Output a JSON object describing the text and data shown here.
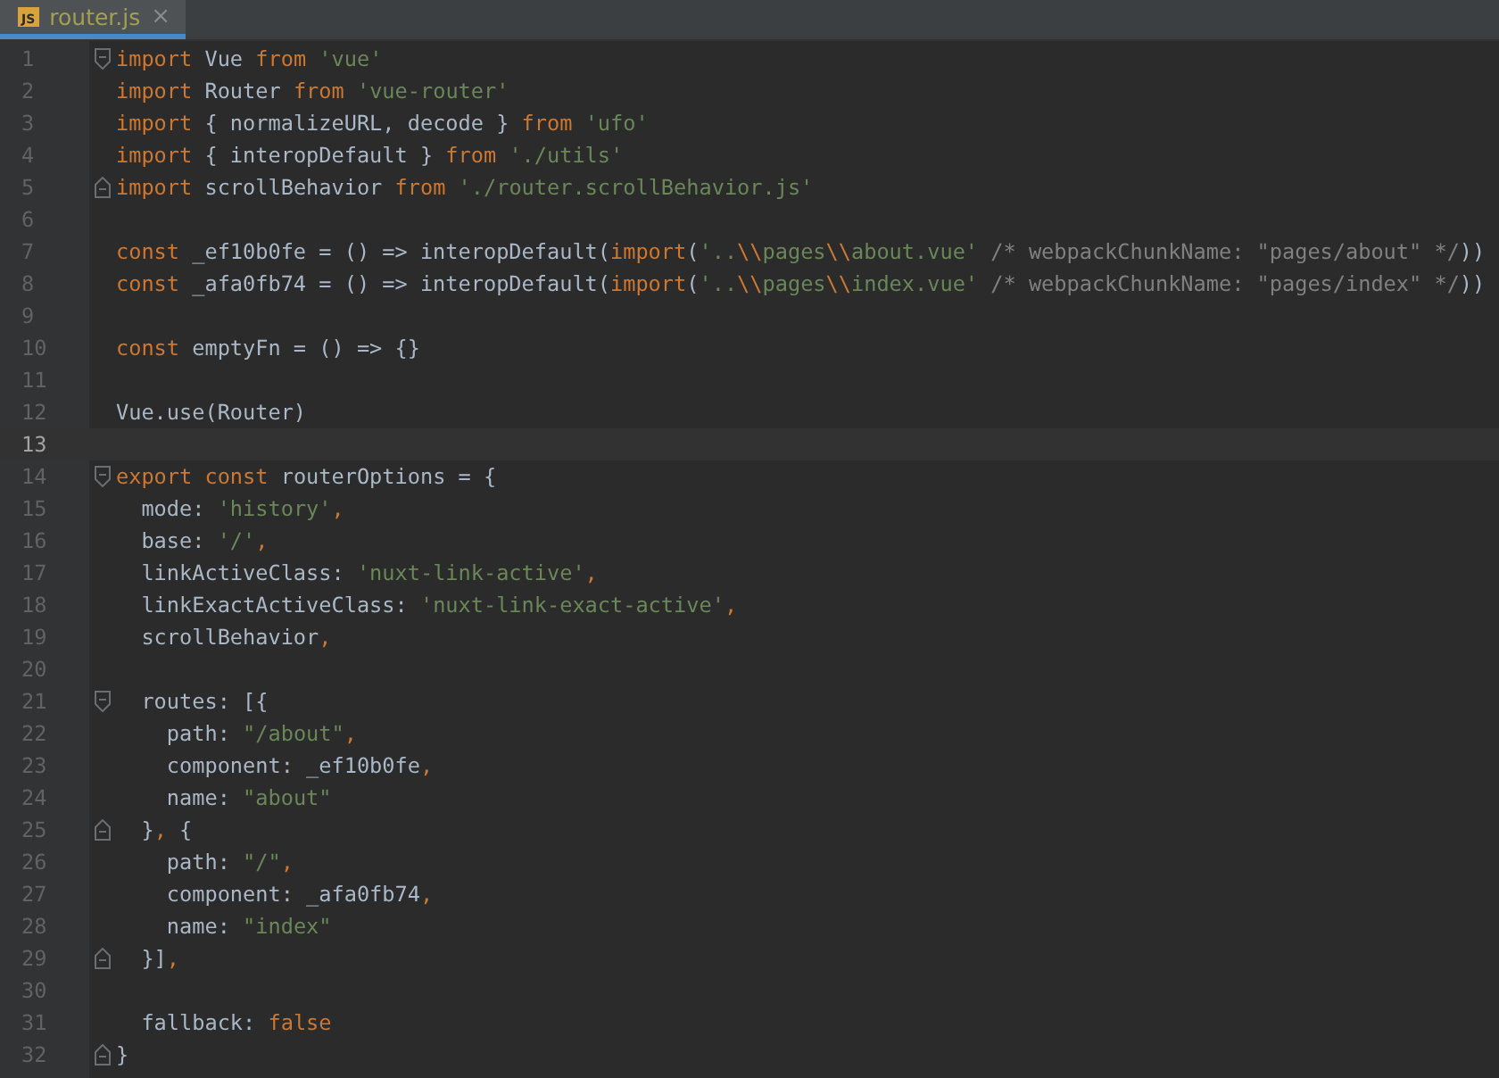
{
  "tab": {
    "label": "router.js",
    "icon_text": "JS",
    "close": "×",
    "selected": true
  },
  "lines": [
    {
      "number": "1",
      "current": false,
      "fold_start": true,
      "tokens": [
        {
          "kind": "kw",
          "t": "import"
        },
        {
          "kind": "pl",
          "t": " Vue "
        },
        {
          "kind": "kw",
          "t": "from"
        },
        {
          "kind": "str",
          "t": " 'vue'"
        }
      ]
    },
    {
      "number": "2",
      "current": false,
      "tokens": [
        {
          "kind": "kw",
          "t": "import"
        },
        {
          "kind": "pl",
          "t": " Router "
        },
        {
          "kind": "kw",
          "t": "from"
        },
        {
          "kind": "str",
          "t": " 'vue-router'"
        }
      ]
    },
    {
      "number": "3",
      "current": false,
      "tokens": [
        {
          "kind": "kw",
          "t": "import"
        },
        {
          "kind": "pl",
          "t": " { normalizeURL, decode } "
        },
        {
          "kind": "kw",
          "t": "from"
        },
        {
          "kind": "str",
          "t": " 'ufo'"
        }
      ]
    },
    {
      "number": "4",
      "current": false,
      "tokens": [
        {
          "kind": "kw",
          "t": "import"
        },
        {
          "kind": "pl",
          "t": " { interopDefault } "
        },
        {
          "kind": "kw",
          "t": "from"
        },
        {
          "kind": "str",
          "t": " './utils'"
        }
      ]
    },
    {
      "number": "5",
      "current": false,
      "fold_end": true,
      "tokens": [
        {
          "kind": "kw",
          "t": "import"
        },
        {
          "kind": "pl",
          "t": " scrollBehavior "
        },
        {
          "kind": "kw",
          "t": "from"
        },
        {
          "kind": "str",
          "t": " './router.scrollBehavior.js'"
        }
      ]
    },
    {
      "number": "6",
      "current": false
    },
    {
      "number": "7",
      "current": false,
      "tokens": [
        {
          "kind": "kw",
          "t": "const"
        },
        {
          "kind": "pl",
          "t": " _ef10b0fe = () => interopDefault("
        },
        {
          "kind": "kw",
          "t": "import"
        },
        {
          "kind": "pl",
          "t": "("
        },
        {
          "kind": "str",
          "t": "'.."
        },
        {
          "kind": "kw",
          "t": "\\\\"
        },
        {
          "kind": "str",
          "t": "pages"
        },
        {
          "kind": "kw",
          "t": "\\\\"
        },
        {
          "kind": "str",
          "t": "about.vue'"
        },
        {
          "kind": "com",
          "t": " /* webpackChunkName: \"pages/about\" */"
        },
        {
          "kind": "pl",
          "t": "))"
        }
      ]
    },
    {
      "number": "8",
      "current": false,
      "tokens": [
        {
          "kind": "kw",
          "t": "const"
        },
        {
          "kind": "pl",
          "t": " _afa0fb74 = () => interopDefault("
        },
        {
          "kind": "kw",
          "t": "import"
        },
        {
          "kind": "pl",
          "t": "("
        },
        {
          "kind": "str",
          "t": "'.."
        },
        {
          "kind": "kw",
          "t": "\\\\"
        },
        {
          "kind": "str",
          "t": "pages"
        },
        {
          "kind": "kw",
          "t": "\\\\"
        },
        {
          "kind": "str",
          "t": "index.vue'"
        },
        {
          "kind": "com",
          "t": " /* webpackChunkName: \"pages/index\" */"
        },
        {
          "kind": "pl",
          "t": "))"
        }
      ]
    },
    {
      "number": "9",
      "current": false
    },
    {
      "number": "10",
      "current": false,
      "tokens": [
        {
          "kind": "kw",
          "t": "const"
        },
        {
          "kind": "pl",
          "t": " emptyFn = () => {}"
        }
      ]
    },
    {
      "number": "11",
      "current": false
    },
    {
      "number": "12",
      "current": false,
      "tokens": [
        {
          "kind": "pl",
          "t": "Vue.use(Router)"
        }
      ]
    },
    {
      "number": "13",
      "current": true
    },
    {
      "number": "14",
      "current": false,
      "fold_start": true,
      "tokens": [
        {
          "kind": "kw",
          "t": "export const"
        },
        {
          "kind": "pl",
          "t": " routerOptions = {"
        }
      ]
    },
    {
      "number": "15",
      "current": false,
      "tokens": [
        {
          "kind": "pl",
          "t": "  mode: "
        },
        {
          "kind": "str",
          "t": "'history'"
        },
        {
          "kind": "kw",
          "t": ","
        }
      ]
    },
    {
      "number": "16",
      "current": false,
      "tokens": [
        {
          "kind": "pl",
          "t": "  base: "
        },
        {
          "kind": "str",
          "t": "'/'"
        },
        {
          "kind": "kw",
          "t": ","
        }
      ]
    },
    {
      "number": "17",
      "current": false,
      "tokens": [
        {
          "kind": "pl",
          "t": "  linkActiveClass: "
        },
        {
          "kind": "str",
          "t": "'nuxt-link-active'"
        },
        {
          "kind": "kw",
          "t": ","
        }
      ]
    },
    {
      "number": "18",
      "current": false,
      "tokens": [
        {
          "kind": "pl",
          "t": "  linkExactActiveClass: "
        },
        {
          "kind": "str",
          "t": "'nuxt-link-exact-active'"
        },
        {
          "kind": "kw",
          "t": ","
        }
      ]
    },
    {
      "number": "19",
      "current": false,
      "tokens": [
        {
          "kind": "pl",
          "t": "  scrollBehavior"
        },
        {
          "kind": "kw",
          "t": ","
        }
      ]
    },
    {
      "number": "20",
      "current": false
    },
    {
      "number": "21",
      "current": false,
      "fold_start": true,
      "tokens": [
        {
          "kind": "pl",
          "t": "  routes: [{"
        }
      ]
    },
    {
      "number": "22",
      "current": false,
      "tokens": [
        {
          "kind": "pl",
          "t": "    path: "
        },
        {
          "kind": "str",
          "t": "\"/about\""
        },
        {
          "kind": "kw",
          "t": ","
        }
      ]
    },
    {
      "number": "23",
      "current": false,
      "tokens": [
        {
          "kind": "pl",
          "t": "    component: _ef10b0fe"
        },
        {
          "kind": "kw",
          "t": ","
        }
      ]
    },
    {
      "number": "24",
      "current": false,
      "tokens": [
        {
          "kind": "pl",
          "t": "    name: "
        },
        {
          "kind": "str",
          "t": "\"about\""
        }
      ]
    },
    {
      "number": "25",
      "current": false,
      "fold_end": true,
      "tokens": [
        {
          "kind": "pl",
          "t": "  }"
        },
        {
          "kind": "kw",
          "t": ","
        },
        {
          "kind": "pl",
          "t": " {"
        }
      ]
    },
    {
      "number": "26",
      "current": false,
      "tokens": [
        {
          "kind": "pl",
          "t": "    path: "
        },
        {
          "kind": "str",
          "t": "\"/\""
        },
        {
          "kind": "kw",
          "t": ","
        }
      ]
    },
    {
      "number": "27",
      "current": false,
      "tokens": [
        {
          "kind": "pl",
          "t": "    component: _afa0fb74"
        },
        {
          "kind": "kw",
          "t": ","
        }
      ]
    },
    {
      "number": "28",
      "current": false,
      "tokens": [
        {
          "kind": "pl",
          "t": "    name: "
        },
        {
          "kind": "str",
          "t": "\"index\""
        }
      ]
    },
    {
      "number": "29",
      "current": false,
      "fold_end": true,
      "tokens": [
        {
          "kind": "pl",
          "t": "  }]"
        },
        {
          "kind": "kw",
          "t": ","
        }
      ]
    },
    {
      "number": "30",
      "current": false
    },
    {
      "number": "31",
      "current": false,
      "tokens": [
        {
          "kind": "pl",
          "t": "  fallback: "
        },
        {
          "kind": "kw",
          "t": "false"
        }
      ]
    },
    {
      "number": "32",
      "current": false,
      "fold_end": true,
      "tokens": [
        {
          "kind": "pl",
          "t": "}"
        }
      ]
    }
  ]
}
